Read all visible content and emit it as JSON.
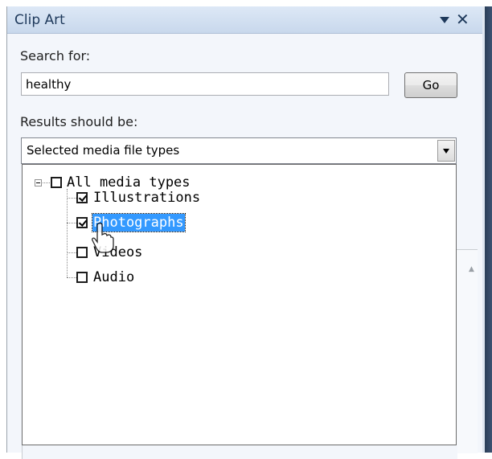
{
  "pane": {
    "title": "Clip Art",
    "dropdown_icon": "triangle-down",
    "close_icon": "close-x",
    "close_glyph": "✕"
  },
  "search": {
    "label": "Search for:",
    "value": "healthy",
    "go_label": "Go"
  },
  "results": {
    "label": "Results should be:",
    "selected": "Selected media file types"
  },
  "media_tree": {
    "root": {
      "label": "All media types",
      "checked": false,
      "expanded": true
    },
    "items": [
      {
        "label": "Illustrations",
        "checked": true,
        "selected": false
      },
      {
        "label": "Photographs",
        "checked": true,
        "selected": true
      },
      {
        "label": "Videos",
        "checked": false,
        "selected": false
      },
      {
        "label": "Audio",
        "checked": false,
        "selected": false
      }
    ]
  },
  "colors": {
    "title_bar": "#c8d8ec",
    "selection": "#3399ff",
    "pane_background": "#f3f6fb"
  }
}
